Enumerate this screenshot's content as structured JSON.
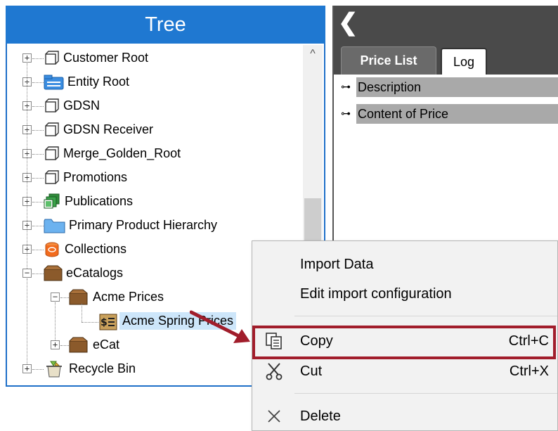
{
  "tree": {
    "title": "Tree",
    "items": [
      {
        "label": "Customer Root",
        "expander": "+"
      },
      {
        "label": "Entity Root",
        "expander": "+"
      },
      {
        "label": "GDSN",
        "expander": "+"
      },
      {
        "label": "GDSN Receiver",
        "expander": "+"
      },
      {
        "label": "Merge_Golden_Root",
        "expander": "+"
      },
      {
        "label": "Promotions",
        "expander": "+"
      },
      {
        "label": "Publications",
        "expander": "+"
      },
      {
        "label": "Primary Product Hierarchy",
        "expander": "+"
      },
      {
        "label": "Collections",
        "expander": "+"
      },
      {
        "label": "eCatalogs",
        "expander": "−"
      },
      {
        "label": "Acme Prices",
        "expander": "−"
      },
      {
        "label": "Acme Spring Prices",
        "expander": ""
      },
      {
        "label": "eCat",
        "expander": "+"
      },
      {
        "label": "Recycle Bin",
        "expander": "+"
      }
    ],
    "scroll_up_glyph": "^"
  },
  "right_panel": {
    "back_glyph": "❮",
    "tabs": [
      {
        "label": "Price List",
        "active": true
      },
      {
        "label": "Log",
        "active": false
      }
    ],
    "attributes": [
      {
        "label": "Description"
      },
      {
        "label": "Content of Price"
      }
    ]
  },
  "context_menu": {
    "items": [
      {
        "label": "Import Data",
        "shortcut": "",
        "icon": ""
      },
      {
        "label": "Edit import configuration",
        "shortcut": "",
        "icon": ""
      },
      {
        "label": "Copy",
        "shortcut": "Ctrl+C",
        "icon": "copy-icon"
      },
      {
        "label": "Cut",
        "shortcut": "Ctrl+X",
        "icon": "scissors-icon"
      },
      {
        "label": "Delete",
        "shortcut": "",
        "icon": "delete-x-icon"
      }
    ]
  },
  "colors": {
    "tree_header": "#1f78d1",
    "right_header": "#4a4a4a",
    "highlight": "#a11d2b",
    "selection": "#cde6fa"
  }
}
